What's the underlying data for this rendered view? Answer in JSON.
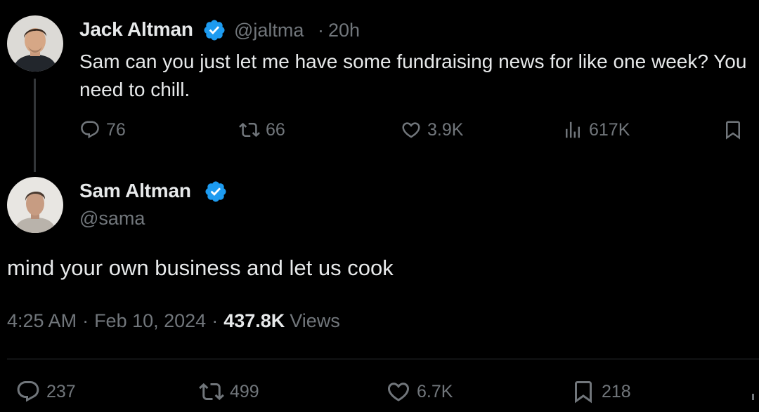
{
  "parent_tweet": {
    "author_name": "Jack Altman",
    "handle": "@jaltma",
    "separator": "·",
    "time": "20h",
    "text": "Sam can you just let me have some fundraising news for like one week? You need to chill.",
    "stats": {
      "replies": "76",
      "retweets": "66",
      "likes": "3.9K",
      "views": "617K"
    },
    "verified": true,
    "avatar_icon": "person-photo-icon"
  },
  "main_tweet": {
    "author_name": "Sam Altman",
    "handle": "@sama",
    "verified": true,
    "avatar_icon": "person-photo-icon",
    "text": "mind your own business and let us cook",
    "timestamp": "4:25 AM",
    "date": "Feb 10, 2024",
    "separator": "·",
    "views_count": "437.8K",
    "views_label": "Views",
    "stats": {
      "replies": "237",
      "retweets": "499",
      "likes": "6.7K",
      "bookmarks": "218"
    }
  },
  "colors": {
    "background": "#000000",
    "text_primary": "#e7e9ea",
    "text_secondary": "#71767b",
    "verified_blue": "#1d9bf0",
    "divider": "#2f3336"
  },
  "icons": {
    "reply": "reply-icon",
    "retweet": "retweet-icon",
    "like": "heart-icon",
    "views": "views-chart-icon",
    "bookmark": "bookmark-icon",
    "share": "share-icon",
    "verified": "verified-badge-icon"
  }
}
